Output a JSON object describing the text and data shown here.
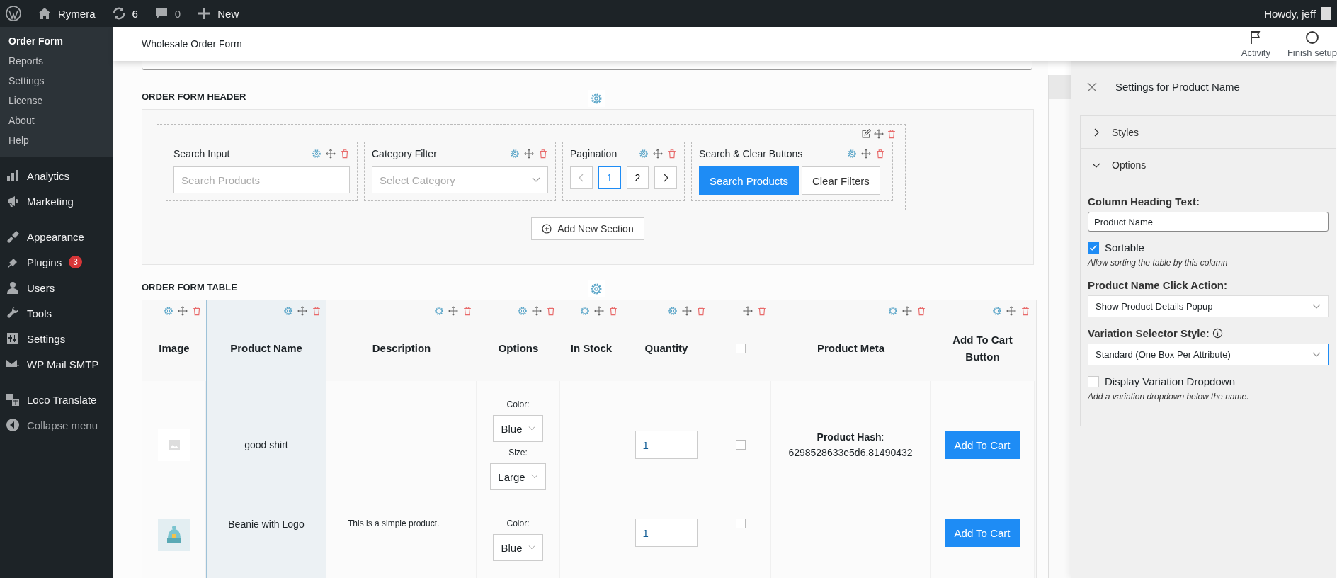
{
  "admin_bar": {
    "site": "Rymera",
    "updates": "6",
    "comments": "0",
    "new": "New",
    "greeting": "Howdy, jeff"
  },
  "sidebar": {
    "submenu": [
      {
        "label": "Order Form",
        "selected": true
      },
      {
        "label": "Reports",
        "selected": false
      },
      {
        "label": "Settings",
        "selected": false
      },
      {
        "label": "License",
        "selected": false
      },
      {
        "label": "About",
        "selected": false
      },
      {
        "label": "Help",
        "selected": false
      }
    ],
    "menu": [
      {
        "label": "Analytics"
      },
      {
        "label": "Marketing"
      },
      {
        "label": "Appearance"
      },
      {
        "label": "Plugins",
        "badge": "3"
      },
      {
        "label": "Users"
      },
      {
        "label": "Tools"
      },
      {
        "label": "Settings"
      },
      {
        "label": "WP Mail SMTP"
      },
      {
        "label": "Loco Translate"
      }
    ],
    "collapse": "Collapse menu"
  },
  "page_header": {
    "title": "Wholesale Order Form",
    "actions": [
      {
        "label": "Activity"
      },
      {
        "label": "Finish setup"
      }
    ]
  },
  "header_section": {
    "heading": "ORDER FORM HEADER",
    "widgets": [
      {
        "kind": "search",
        "title": "Search Input",
        "placeholder": "Search Products"
      },
      {
        "kind": "select",
        "title": "Category Filter",
        "placeholder": "Select Category"
      },
      {
        "kind": "pagination",
        "title": "Pagination",
        "pages": [
          {
            "label": "1",
            "selected": true
          },
          {
            "label": "2",
            "selected": false
          }
        ]
      },
      {
        "kind": "buttons",
        "title": "Search & Clear Buttons",
        "buttons": [
          {
            "label": "Search Products",
            "primary": true
          },
          {
            "label": "Clear Filters",
            "primary": false
          }
        ]
      }
    ],
    "add_button": "Add New Section"
  },
  "table_section": {
    "heading": "ORDER FORM TABLE",
    "columns": [
      {
        "kind": "text",
        "label": "Image",
        "settings_icon": true,
        "selected": false
      },
      {
        "kind": "text",
        "label": "Product Name",
        "settings_icon": true,
        "selected": true
      },
      {
        "kind": "text",
        "label": "Description",
        "settings_icon": true,
        "selected": false
      },
      {
        "kind": "text",
        "label": "Options",
        "settings_icon": true,
        "selected": false
      },
      {
        "kind": "text",
        "label": "In Stock",
        "settings_icon": true,
        "selected": false
      },
      {
        "kind": "text",
        "label": "Quantity",
        "settings_icon": true,
        "selected": false
      },
      {
        "kind": "checkbox",
        "checked": false,
        "settings_icon": false,
        "selected": false
      },
      {
        "kind": "text",
        "label": "Product Meta",
        "settings_icon": true,
        "selected": false
      },
      {
        "kind": "text",
        "label": "Add To Cart Button",
        "settings_icon": true,
        "selected": false
      }
    ],
    "rows": [
      {
        "image": {
          "kind": "placeholder"
        },
        "name": "good shirt",
        "options": [
          {
            "label": "Color:",
            "value": "Blue"
          },
          {
            "label": "Size:",
            "value": "Large"
          }
        ],
        "quantity": "1",
        "checked": false,
        "meta": {
          "label": "**Product Hash**:",
          "value": "6298528633e5d6.81490432"
        },
        "button": "Add To Cart"
      },
      {
        "image": {
          "kind": "thumbnail"
        },
        "name": "Beanie with Logo",
        "description": "This is a simple product.",
        "options": [
          {
            "label": "Color:",
            "value": "Blue"
          }
        ],
        "quantity": "1",
        "checked": false,
        "button": "Add To Cart"
      }
    ]
  },
  "settings_panel": {
    "title": "Settings for Product Name",
    "sections": [
      {
        "label": "Styles",
        "expanded": false
      },
      {
        "label": "Options",
        "expanded": true
      }
    ],
    "fields": [
      {
        "kind": "text",
        "label": "Column Heading Text:",
        "value": "Product Name"
      },
      {
        "kind": "checkbox",
        "label": "Sortable",
        "checked": true,
        "help": "Allow sorting the table by this column"
      },
      {
        "kind": "select",
        "label": "Product Name Click Action:",
        "value": "Show Product Details Popup",
        "focused": false
      },
      {
        "kind": "select",
        "label": "Variation Selector Style:",
        "info": true,
        "value": "Standard (One Box Per Attribute)",
        "focused": true
      },
      {
        "kind": "checkbox",
        "label": "Display Variation Dropdown",
        "checked": false,
        "help": "Add a variation dropdown below the name."
      }
    ]
  }
}
